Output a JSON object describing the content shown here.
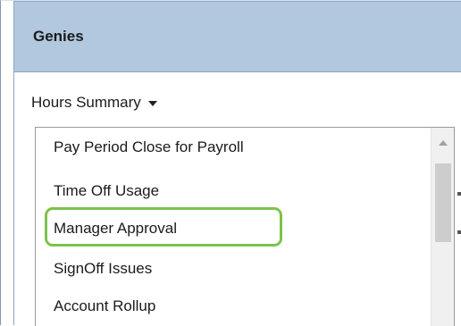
{
  "panel": {
    "title": "Genies"
  },
  "summary_selector": {
    "label": "Hours Summary"
  },
  "genie_list": {
    "items": [
      {
        "label": "Pay Period Close for Payroll"
      },
      {
        "label": "Time Off Usage"
      },
      {
        "label": "Manager Approval",
        "highlighted": true
      },
      {
        "label": "SignOff Issues"
      },
      {
        "label": "Account Rollup"
      }
    ]
  },
  "colors": {
    "header_bg": "#b1c8df",
    "highlight_border": "#7dc24b",
    "scrollbar_thumb": "#cdcdcd"
  }
}
